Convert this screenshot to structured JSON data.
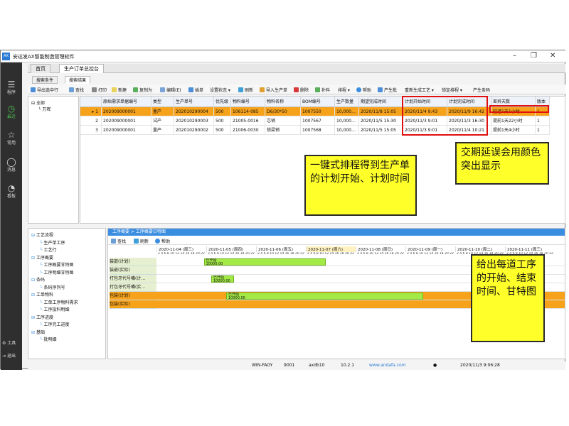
{
  "app": {
    "title": "安达发AX智能制造管理软件",
    "logo_text": "AX"
  },
  "nav": {
    "items": [
      {
        "icon": "program-icon",
        "label": "程序"
      },
      {
        "icon": "recent-icon",
        "label": "最近"
      },
      {
        "icon": "star-icon",
        "label": "常用"
      },
      {
        "icon": "message-icon",
        "label": "消息"
      },
      {
        "icon": "dashboard-icon",
        "label": "看板"
      }
    ],
    "tools": "工具",
    "logout": "退出"
  },
  "tabs": [
    {
      "label": "首页"
    },
    {
      "label": "生产订单总控台"
    }
  ],
  "subtabs": [
    {
      "label": "搜索条件"
    },
    {
      "label": "搜索结果"
    }
  ],
  "toolbar": [
    "导出选中行",
    "查找",
    "打印",
    "新建",
    "复制为",
    "编辑(E)",
    "插单",
    "设置状态 ▾",
    "刷新",
    "导入生产单",
    "删除",
    "补料",
    "排程 ▾",
    "帮助",
    "产生批",
    "重新生成工艺 ▾",
    "锁定排程 ▾",
    "产生条码"
  ],
  "tree_top": [
    {
      "label": "全部"
    },
    {
      "label": "万晖"
    }
  ],
  "grid": {
    "columns": [
      "原始需求单据编号",
      "类型",
      "生产单号",
      "优先级",
      "物料编号",
      "物料名称",
      "BOM编号",
      "生产数量",
      "期望完成时间",
      "计划开始时间",
      "计划完成时间",
      "差异天数",
      "版本"
    ],
    "rows": [
      {
        "no": "1",
        "cells": [
          "202009000001",
          "量产",
          "202010290004",
          "500",
          "106114-085",
          "D6/30*50",
          "1007550",
          "10,000…",
          "2020/11/8 15:05",
          "2020/11/4 9:43",
          "2020/11/9 16:42",
          "延迟1天1小时",
          "1"
        ]
      },
      {
        "no": "2",
        "cells": [
          "202009000001",
          "试产",
          "202010290003",
          "500",
          "21005-0016",
          "芯销",
          "1007567",
          "10,000…",
          "2020/11/5 15:30",
          "2020/11/3 9:01",
          "2020/11/3 16:30",
          "提前1天22小时",
          "1"
        ]
      },
      {
        "no": "3",
        "cells": [
          "202009000001",
          "量产",
          "202010290002",
          "500",
          "21006-0030",
          "锁梁销",
          "1007568",
          "10,000…",
          "2020/11/5 15:05",
          "2020/11/3 9:01",
          "2020/11/4 10:21",
          "提前1天4小时",
          "1"
        ]
      }
    ]
  },
  "tree_bottom": [
    {
      "label": "工艺流程",
      "level": 0
    },
    {
      "label": "生产单工序",
      "level": 1
    },
    {
      "label": "工艺行",
      "level": 1
    },
    {
      "label": "工序概要",
      "level": 0
    },
    {
      "label": "工序概要甘特图",
      "level": 1
    },
    {
      "label": "工序明细甘特图",
      "level": 1
    },
    {
      "label": "条码",
      "level": 0
    },
    {
      "label": "条码序列号",
      "level": 1
    },
    {
      "label": "工单物料",
      "level": 0
    },
    {
      "label": "工单工序物料需求",
      "level": 1
    },
    {
      "label": "工序投料明细",
      "level": 1
    },
    {
      "label": "工序进度",
      "level": 0
    },
    {
      "label": "工序完工进度",
      "level": 1
    },
    {
      "label": "基础",
      "level": 0
    },
    {
      "label": "批明细",
      "level": 1
    }
  ],
  "gantt": {
    "breadcrumb": "工序概要 > 工序概要甘特图",
    "toolbar": [
      "查找",
      "刷新",
      "帮助"
    ],
    "dates": [
      "2020-11-04 (周三)",
      "2020-11-05 (周四)",
      "2020-11-06 (周五)",
      "2020-11-07 (周六)",
      "2020-11-08 (周日)",
      "2020-11-09 (周一)",
      "2020-11-10 (周二)",
      "2020-11-11 (周三)"
    ],
    "hours": "2 4 6 8 10 12 14 16 18 20 22",
    "rows": [
      {
        "label": "装嵌(计划)",
        "highlight": false
      },
      {
        "label": "装嵌(实际)",
        "highlight": false
      },
      {
        "label": "打包牙代号嘴(计…",
        "highlight": false
      },
      {
        "label": "打包牙代号嘴(实…",
        "highlight": false
      },
      {
        "label": "包装(计划)",
        "highlight": true
      },
      {
        "label": "包装(实际)",
        "highlight": true
      }
    ],
    "bars": [
      {
        "row": 0,
        "status": "已开始",
        "qty": "10000.00",
        "start": 0.95,
        "end": 3.4
      },
      {
        "row": 2,
        "status": "已开始",
        "qty": "10000.00",
        "start": 1.1,
        "end": 1.55
      },
      {
        "row": 4,
        "status": "已开始",
        "qty": "10000.00",
        "start": 1.4,
        "end": 5.35
      }
    ]
  },
  "status": {
    "host": "10.2.1",
    "site": "www.andafa.com",
    "port": "9001",
    "db": "axdb10",
    "datetime": "2020/11/3 9:06:28",
    "server": "WIN-FAOY"
  },
  "annotations": {
    "plan_callout": "一键式排程得到生产单的计划开始、计划时间",
    "delay_callout": "交期延误会用颜色突出显示",
    "gantt_callout": "给出每道工序的开始、结束时间、甘特图"
  },
  "colors": {
    "accent": "#3b8de0",
    "selected_row": "#f7a21b",
    "callout": "#ffff2a",
    "bar": "#a4ea47",
    "highlight_box": "#e01010"
  }
}
